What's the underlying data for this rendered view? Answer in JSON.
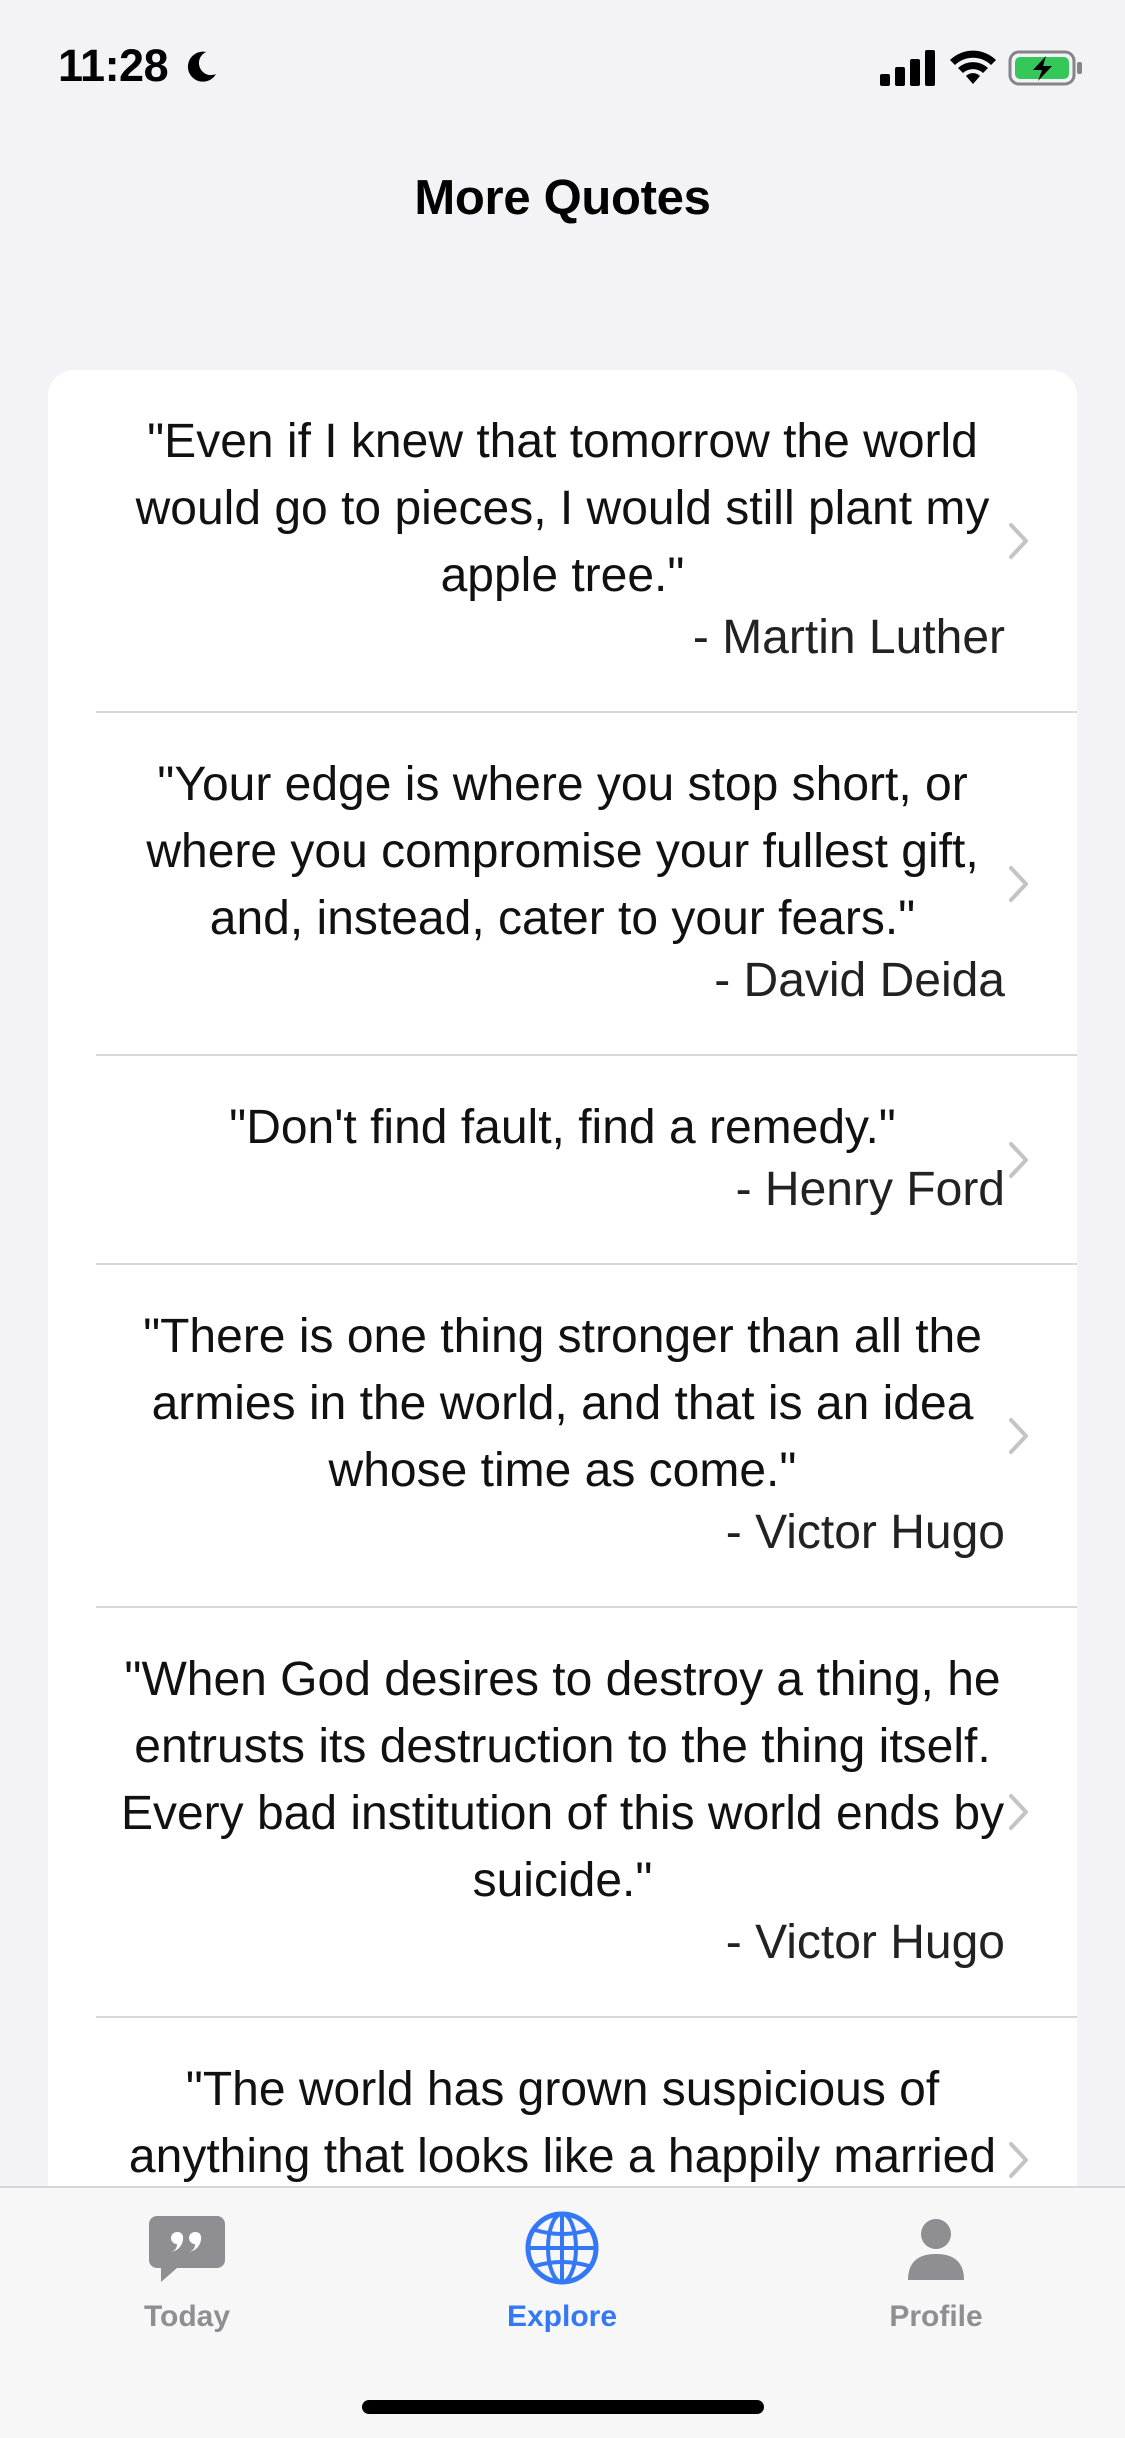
{
  "status_bar": {
    "time": "11:28",
    "icons": [
      "moon-icon",
      "cellular-signal-icon",
      "wifi-icon",
      "battery-charging-icon"
    ]
  },
  "header": {
    "title": "More Quotes"
  },
  "quotes": [
    {
      "text": "\"Even if I knew that tomorrow the world would go to pieces, I would still plant my apple tree.\"",
      "author": "- Martin Luther"
    },
    {
      "text": "\"Your edge is where you stop short, or where you compromise your fullest gift, and, instead, cater to your fears.\"",
      "author": "- David Deida"
    },
    {
      "text": "\"Don't find fault, find a remedy.\"",
      "author": "- Henry Ford"
    },
    {
      "text": "\"There is one thing stronger than all the armies in the world, and that is an idea whose time as come.\"",
      "author": "- Victor Hugo"
    },
    {
      "text": "\"When God desires to destroy a thing, he entrusts its destruction to the thing itself. Every bad institution of this world ends by suicide.\"",
      "author": "- Victor Hugo"
    },
    {
      "text": "\"The world has grown suspicious of anything that looks like a happily married life.\"",
      "author": ""
    }
  ],
  "tab_bar": {
    "tabs": [
      {
        "label": "Today",
        "icon": "quote-bubble-icon",
        "active": false
      },
      {
        "label": "Explore",
        "icon": "globe-icon",
        "active": true
      },
      {
        "label": "Profile",
        "icon": "person-icon",
        "active": false
      }
    ],
    "active_color": "#3478f6",
    "inactive_color": "#8e8e93"
  }
}
